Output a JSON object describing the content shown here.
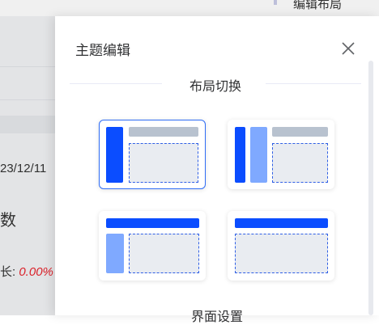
{
  "background": {
    "topbar_text": "编辑布局",
    "date_text": "23/12/11",
    "number_label": "数",
    "growth_label": "长:",
    "growth_value": "0.00%"
  },
  "drawer": {
    "title": "主题编辑",
    "close_icon": "close-icon",
    "section_layout_label": "布局切换",
    "section_page_label": "界面设置",
    "layouts": [
      {
        "name": "side-menu-layout",
        "selected": true
      },
      {
        "name": "double-column-layout",
        "selected": false
      },
      {
        "name": "top-side-layout",
        "selected": false
      },
      {
        "name": "top-menu-layout",
        "selected": false
      }
    ]
  },
  "colors": {
    "primary": "#0b4dff",
    "primary_light": "#7fa9ff",
    "header_gray": "#b8c2cf",
    "content_bg": "#e9ecf1",
    "growth_red": "#e8232c"
  }
}
